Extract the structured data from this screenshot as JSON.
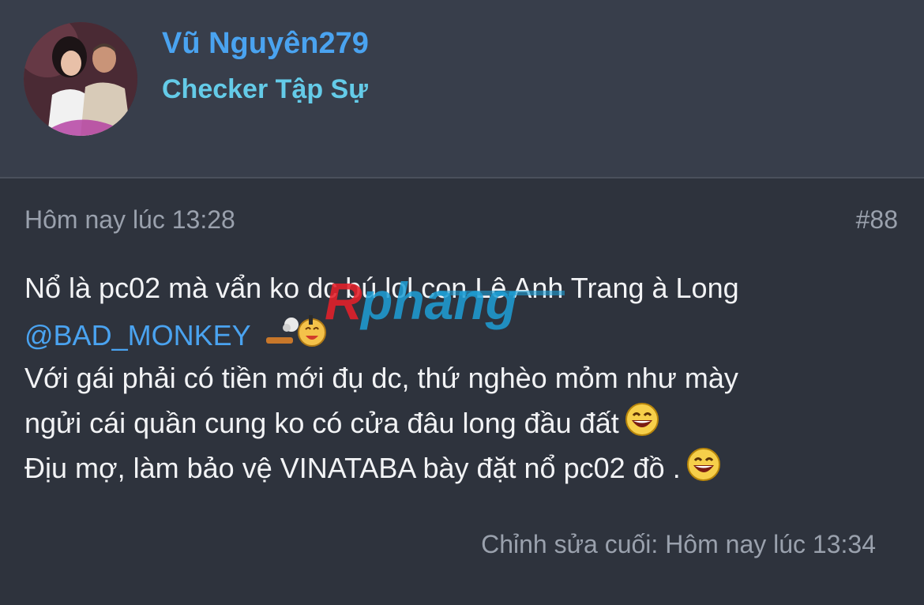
{
  "user": {
    "name": "Vũ Nguyên279",
    "title": "Checker Tập Sự"
  },
  "post": {
    "timestamp": "Hôm nay lúc 13:28",
    "number": "#88",
    "lines": {
      "l1": "Nổ là pc02 mà vẩn ko dc bú lol con Lê Anh Trang à Long",
      "mention": "@BAD_MONKEY",
      "l3": "Với gái phải có tiền mới đụ dc, thứ nghèo mỏm như mày",
      "l4": "ngửi cái quần cung ko có cửa đâu long đầu đất",
      "l5": "Địu mợ, làm bảo vệ VINATABA bày đặt nổ pc02 đồ ."
    },
    "edited": "Chỉnh sửa cuối: Hôm nay lúc 13:34"
  },
  "watermark": {
    "text": "Rphang",
    "color_red": "#e5202a",
    "color_blue": "#1e9fd6"
  },
  "icons": {
    "avatar": "avatar-photo",
    "laugh": "laughing-emoji-icon",
    "sticker": "fart-sticker-icon"
  }
}
